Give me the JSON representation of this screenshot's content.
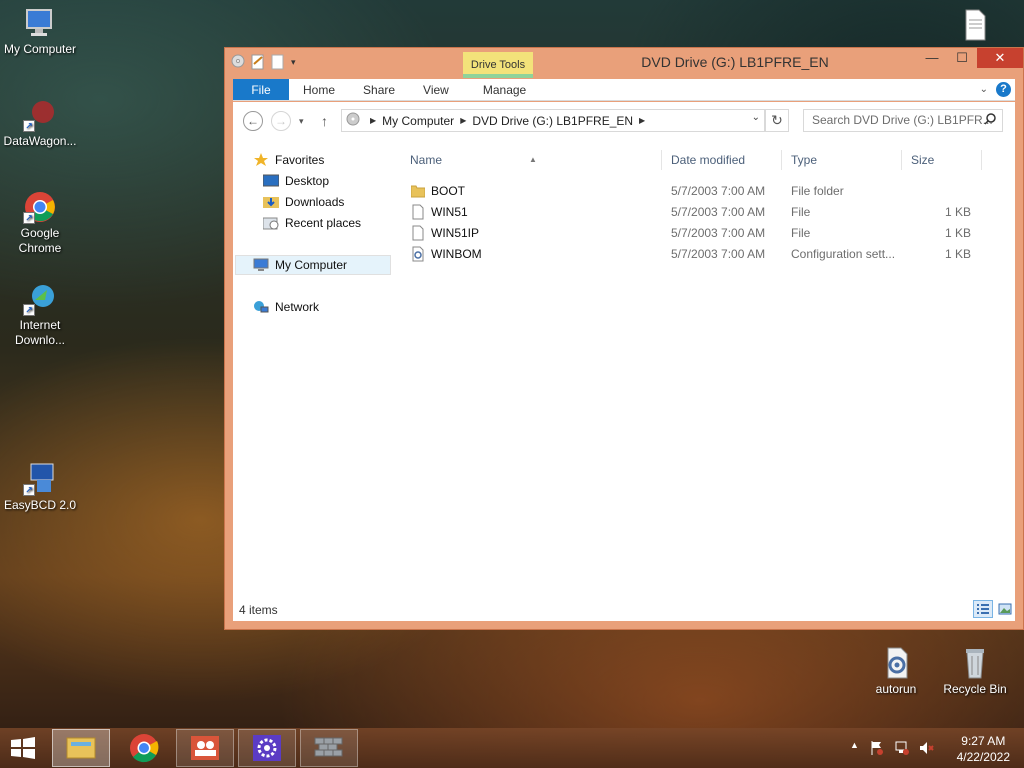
{
  "desktop": {
    "icons": [
      {
        "label": "My Computer"
      },
      {
        "label": "DataWagon..."
      },
      {
        "label": "Google Chrome"
      },
      {
        "label": "Internet Downlo..."
      },
      {
        "label": "EasyBCD 2.0"
      },
      {
        "label": "autorun"
      },
      {
        "label": "Recycle Bin"
      }
    ]
  },
  "window": {
    "title": "DVD Drive (G:) LB1PFRE_EN",
    "contextual_tab": "Drive Tools",
    "controls": {
      "minimize": "—",
      "maximize": "☐",
      "close": "✕"
    },
    "ribbon_tabs": [
      "File",
      "Home",
      "Share",
      "View",
      "Manage"
    ],
    "help": "?",
    "address": {
      "segments": [
        "My Computer",
        "DVD Drive (G:) LB1PFRE_EN"
      ]
    },
    "search_placeholder": "Search DVD Drive (G:) LB1PFR...",
    "nav": {
      "favorites": "Favorites",
      "desktop": "Desktop",
      "downloads": "Downloads",
      "recent": "Recent places",
      "computer": "My Computer",
      "network": "Network"
    },
    "columns": {
      "name": "Name",
      "date": "Date modified",
      "type": "Type",
      "size": "Size"
    },
    "files": [
      {
        "name": "BOOT",
        "date": "5/7/2003 7:00 AM",
        "type": "File folder",
        "size": ""
      },
      {
        "name": "WIN51",
        "date": "5/7/2003 7:00 AM",
        "type": "File",
        "size": "1 KB"
      },
      {
        "name": "WIN51IP",
        "date": "5/7/2003 7:00 AM",
        "type": "File",
        "size": "1 KB"
      },
      {
        "name": "WINBOM",
        "date": "5/7/2003 7:00 AM",
        "type": "Configuration sett...",
        "size": "1 KB"
      }
    ],
    "status": "4 items"
  },
  "taskbar": {
    "time": "9:27 AM",
    "date": "4/22/2022"
  },
  "colors": {
    "window_frame": "#e9a07a",
    "file_tab": "#1979ca",
    "close_button": "#c7412f",
    "drive_tools": "#f3e27a"
  }
}
